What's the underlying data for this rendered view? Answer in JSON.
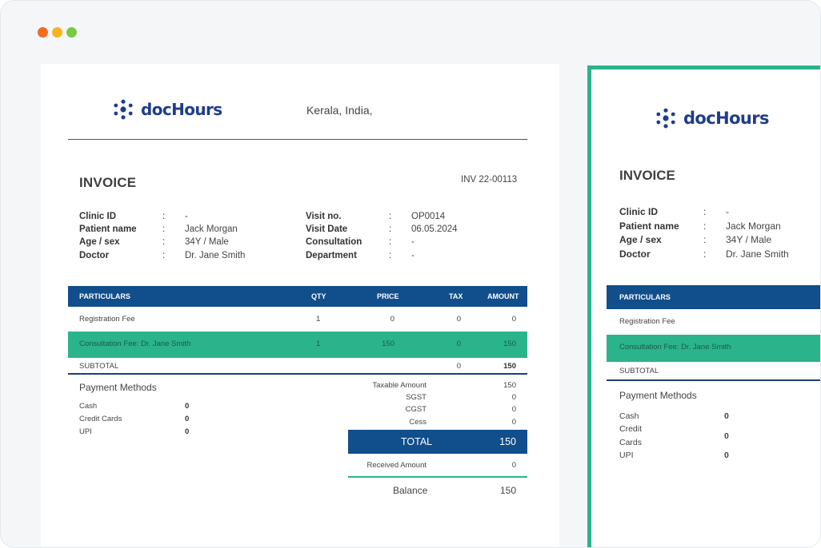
{
  "window": {
    "dots": [
      "#f26b22",
      "#f7b321",
      "#7ac943"
    ]
  },
  "brand": {
    "name": "docHours",
    "color": "#1f3d8a"
  },
  "invoice": {
    "address": "Kerala, India,",
    "title": "INVOICE",
    "number": "INV 22-00113",
    "left_info": [
      {
        "label": "Clinic ID",
        "value": "-"
      },
      {
        "label": "Patient name",
        "value": "Jack Morgan"
      },
      {
        "label": "Age / sex",
        "value": "34Y / Male"
      },
      {
        "label": "Doctor",
        "value": "Dr. Jane Smith"
      }
    ],
    "right_info": [
      {
        "label": "Visit no.",
        "value": "OP0014"
      },
      {
        "label": "Visit Date",
        "value": "06.05.2024"
      },
      {
        "label": "Consultation",
        "value": "-"
      },
      {
        "label": "Department",
        "value": "-"
      }
    ],
    "colon": ":",
    "table": {
      "headers": [
        "PARTICULARS",
        "QTY",
        "PRICE",
        "TAX",
        "AMOUNT"
      ],
      "rows": [
        {
          "particulars": "Registration Fee",
          "qty": "1",
          "price": "0",
          "tax": "0",
          "amount": "0"
        },
        {
          "particulars": "Consultation Fee: Dr. Jane Smith",
          "qty": "1",
          "price": "150",
          "tax": "0",
          "amount": "150"
        }
      ],
      "subtotal": {
        "label": "SUBTOTAL",
        "tax": "0",
        "amount": "150"
      }
    },
    "payment_methods": {
      "title": "Payment Methods",
      "items": [
        {
          "label": "Cash",
          "value": "0"
        },
        {
          "label": "Credit Cards",
          "value": "0"
        },
        {
          "label": "UPI",
          "value": "0"
        }
      ]
    },
    "summary": [
      {
        "label": "Taxable Amount",
        "value": "150"
      },
      {
        "label": "SGST",
        "value": "0"
      },
      {
        "label": "CGST",
        "value": "0"
      },
      {
        "label": "Cess",
        "value": "0"
      }
    ],
    "total": {
      "label": "TOTAL",
      "value": "150"
    },
    "received": {
      "label": "Received Amount",
      "value": "0"
    },
    "balance": {
      "label": "Balance",
      "value": "150"
    }
  },
  "side_invoice": {
    "title": "INVOICE",
    "info": [
      {
        "label": "Clinic ID",
        "value": "-"
      },
      {
        "label": "Patient name",
        "value": "Jack Morgan"
      },
      {
        "label": "Age / sex",
        "value": "34Y / Male"
      },
      {
        "label": "Doctor",
        "value": "Dr. Jane Smith"
      }
    ],
    "table_header": "PARTICULARS",
    "rows": [
      "Registration Fee",
      "Consultation Fee: Dr. Jane Smith"
    ],
    "subtotal": "SUBTOTAL",
    "payment_title": "Payment Methods",
    "payments": [
      {
        "label": "Cash",
        "value": "0"
      },
      {
        "label": "Credit",
        "value": ""
      },
      {
        "label": "Cards",
        "value": "0"
      },
      {
        "label": "UPI",
        "value": "0"
      }
    ]
  },
  "colors": {
    "navy": "#114e8c",
    "green": "#2bb38c"
  }
}
